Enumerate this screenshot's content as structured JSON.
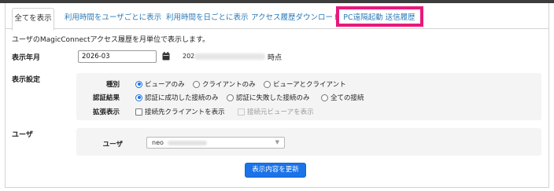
{
  "tabs": [
    {
      "label": "全てを表示",
      "active": true
    },
    {
      "label": "利用時間をユーザごとに表示",
      "active": false
    },
    {
      "label": "利用時間を日ごとに表示",
      "active": false
    },
    {
      "label": "アクセス履歴ダウンロード",
      "active": false
    },
    {
      "label": "PC遠隔起動 送信履歴",
      "active": false
    }
  ],
  "description": "ユーザのMagicConnectアクセス履歴を月単位で表示します。",
  "period": {
    "label": "表示年月",
    "value": "2026-03",
    "timestamp_prefix": "202",
    "timestamp_suffix": "時点"
  },
  "display_settings": {
    "label": "表示設定",
    "type": {
      "label": "種別",
      "options": [
        "ビューアのみ",
        "クライアントのみ",
        "ビューアとクライアント"
      ],
      "selected": "ビューアのみ"
    },
    "auth_result": {
      "label": "認証結果",
      "options": [
        "認証に成功した接続のみ",
        "認証に失敗した接続のみ",
        "全ての接続"
      ],
      "selected": "認証に成功した接続のみ"
    },
    "extended": {
      "label": "拡張表示",
      "options": [
        {
          "label": "接続先クライアントを表示",
          "checked": false,
          "disabled": false
        },
        {
          "label": "接続元ビューアを表示",
          "checked": false,
          "disabled": true
        }
      ]
    }
  },
  "user": {
    "section_label": "ユーザ",
    "field_label": "ユーザ",
    "value": "neo"
  },
  "update_button": "表示内容を更新",
  "colors": {
    "accent": "#1a73e8",
    "link": "#2a7ab8",
    "highlight": "#e8197b"
  },
  "icons": {
    "calendar": "calendar-icon",
    "dropdown": "chevron-down-icon"
  }
}
